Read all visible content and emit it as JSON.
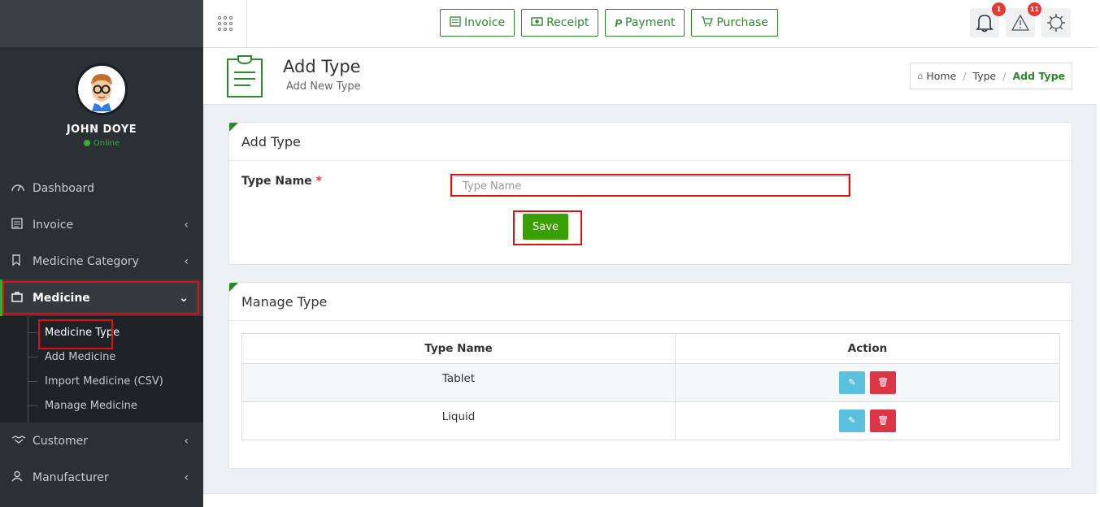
{
  "user": {
    "name": "JOHN DOYE",
    "status": "Online"
  },
  "sidebar": {
    "items": [
      {
        "label": "Dashboard",
        "icon": "dashboard-icon"
      },
      {
        "label": "Invoice",
        "icon": "invoice-icon"
      },
      {
        "label": "Medicine Category",
        "icon": "bookmark-icon"
      },
      {
        "label": "Medicine",
        "icon": "briefcase-icon"
      },
      {
        "label": "Customer",
        "icon": "handshake-icon"
      },
      {
        "label": "Manufacturer",
        "icon": "user-icon"
      }
    ],
    "submenu": [
      "Medicine Type",
      "Add Medicine",
      "Import Medicine (CSV)",
      "Manage Medicine"
    ]
  },
  "topbar": {
    "buttons": [
      {
        "label": "Invoice",
        "icon": "invoice-icon"
      },
      {
        "label": "Receipt",
        "icon": "money-icon"
      },
      {
        "label": "Payment",
        "icon": "paypal-icon"
      },
      {
        "label": "Purchase",
        "icon": "cart-icon"
      }
    ],
    "notifications_count": "1",
    "alerts_count": "11"
  },
  "page": {
    "title": "Add Type",
    "subtitle": "Add New Type",
    "breadcrumb": [
      "Home",
      "Type",
      "Add Type"
    ]
  },
  "form": {
    "title": "Add Type",
    "label": "Type Name",
    "required_mark": "*",
    "placeholder": "Type Name",
    "value": "",
    "save_label": "Save"
  },
  "manage": {
    "title": "Manage Type",
    "columns": [
      "Type Name",
      "Action"
    ],
    "rows": [
      "Tablet",
      "Liquid"
    ]
  },
  "colors": {
    "accent": "#2a8a2a",
    "save": "#3aa000",
    "edit": "#5bc0de",
    "delete": "#dc3545",
    "highlight": "#e01010"
  }
}
